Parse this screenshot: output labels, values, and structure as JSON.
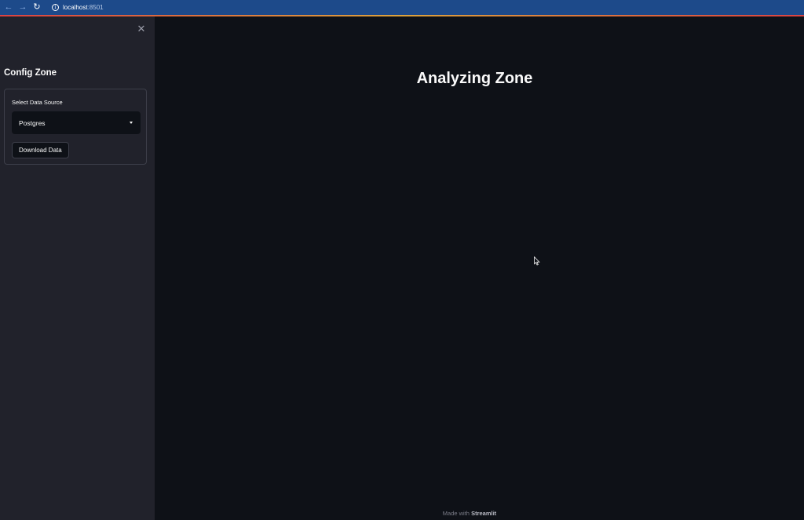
{
  "browser": {
    "url_host": "localhost",
    "url_port": ":8501",
    "back_icon": "back-arrow-icon",
    "forward_icon": "forward-arrow-icon",
    "reload_icon": "reload-icon",
    "info_icon": "info-icon"
  },
  "sidebar": {
    "title": "Config Zone",
    "close_icon": "close-icon",
    "form": {
      "select_label": "Select Data Source",
      "select_value": "Postgres",
      "download_label": "Download Data"
    }
  },
  "main": {
    "title": "Analyzing Zone"
  },
  "footer": {
    "prefix": "Made with ",
    "brand": "Streamlit"
  },
  "colors": {
    "background": "#0e1117",
    "sidebar": "#21222b",
    "browser_bar": "#1d4a8a",
    "text": "#fafafa"
  }
}
